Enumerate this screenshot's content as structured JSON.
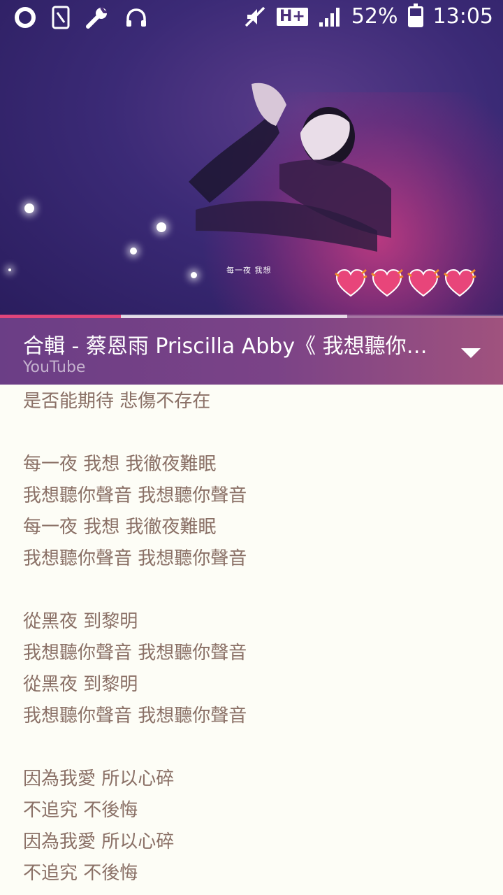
{
  "status_bar": {
    "left_icons": [
      "opera-icon",
      "sim-card-icon",
      "wrench-icon",
      "headset-icon"
    ],
    "right_icons": [
      "mute-icon"
    ],
    "network": "H+",
    "battery": "52%",
    "battery_level": 0.52,
    "time": "13:05"
  },
  "video": {
    "caption": "每一夜 我想",
    "hearts": 4,
    "colors": {
      "accent": "#e0457b",
      "background": "#2a1d5e",
      "heart": "#e8457a"
    },
    "progress": {
      "played": 0.24,
      "buffered": 0.69
    }
  },
  "now_playing": {
    "title": "合輯 - 蔡恩雨 Priscilla Abby《 我想聽你聲音 》",
    "source": "YouTube"
  },
  "lyrics": [
    "是否能期待 悲傷不存在",
    "",
    "每一夜 我想 我徹夜難眠",
    "我想聽你聲音 我想聽你聲音",
    "每一夜 我想 我徹夜難眠",
    "我想聽你聲音 我想聽你聲音",
    "",
    "從黑夜 到黎明",
    "我想聽你聲音 我想聽你聲音",
    "從黑夜 到黎明",
    "我想聽你聲音 我想聽你聲音",
    "",
    "因為我愛 所以心碎",
    "不追究 不後悔",
    "因為我愛 所以心碎",
    "不追究 不後悔"
  ]
}
